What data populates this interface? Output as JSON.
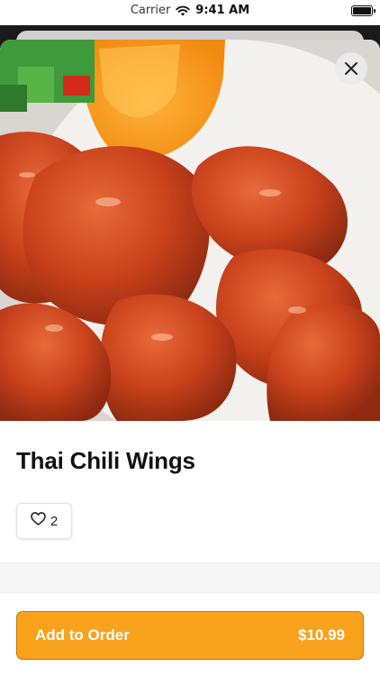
{
  "status_bar": {
    "carrier": "Carrier",
    "time": "9:41 AM"
  },
  "item": {
    "title": "Thai Chili Wings",
    "likes": "2",
    "image": "photo of glazed chili wings with orange slice and diced vegetables"
  },
  "actions": {
    "add_label": "Add to Order",
    "price": "$10.99"
  },
  "icons": {
    "close": "close-icon",
    "like": "heart-icon",
    "wifi": "wifi-icon",
    "battery": "battery-icon"
  },
  "colors": {
    "accent": "#f9a21b",
    "accent_border": "#c27a0c",
    "wing": "#c8401a"
  }
}
